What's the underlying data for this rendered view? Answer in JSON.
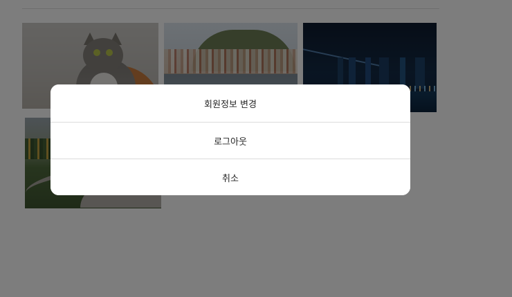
{
  "dialog": {
    "items": [
      {
        "label": "회원정보 변경"
      },
      {
        "label": "로그아웃"
      },
      {
        "label": "취소"
      }
    ]
  },
  "colors": {
    "overlay": "rgba(0,0,0,0.5)",
    "sheet_background": "#ffffff",
    "text": "#262626",
    "divider": "#dbdbdb"
  },
  "icons": []
}
